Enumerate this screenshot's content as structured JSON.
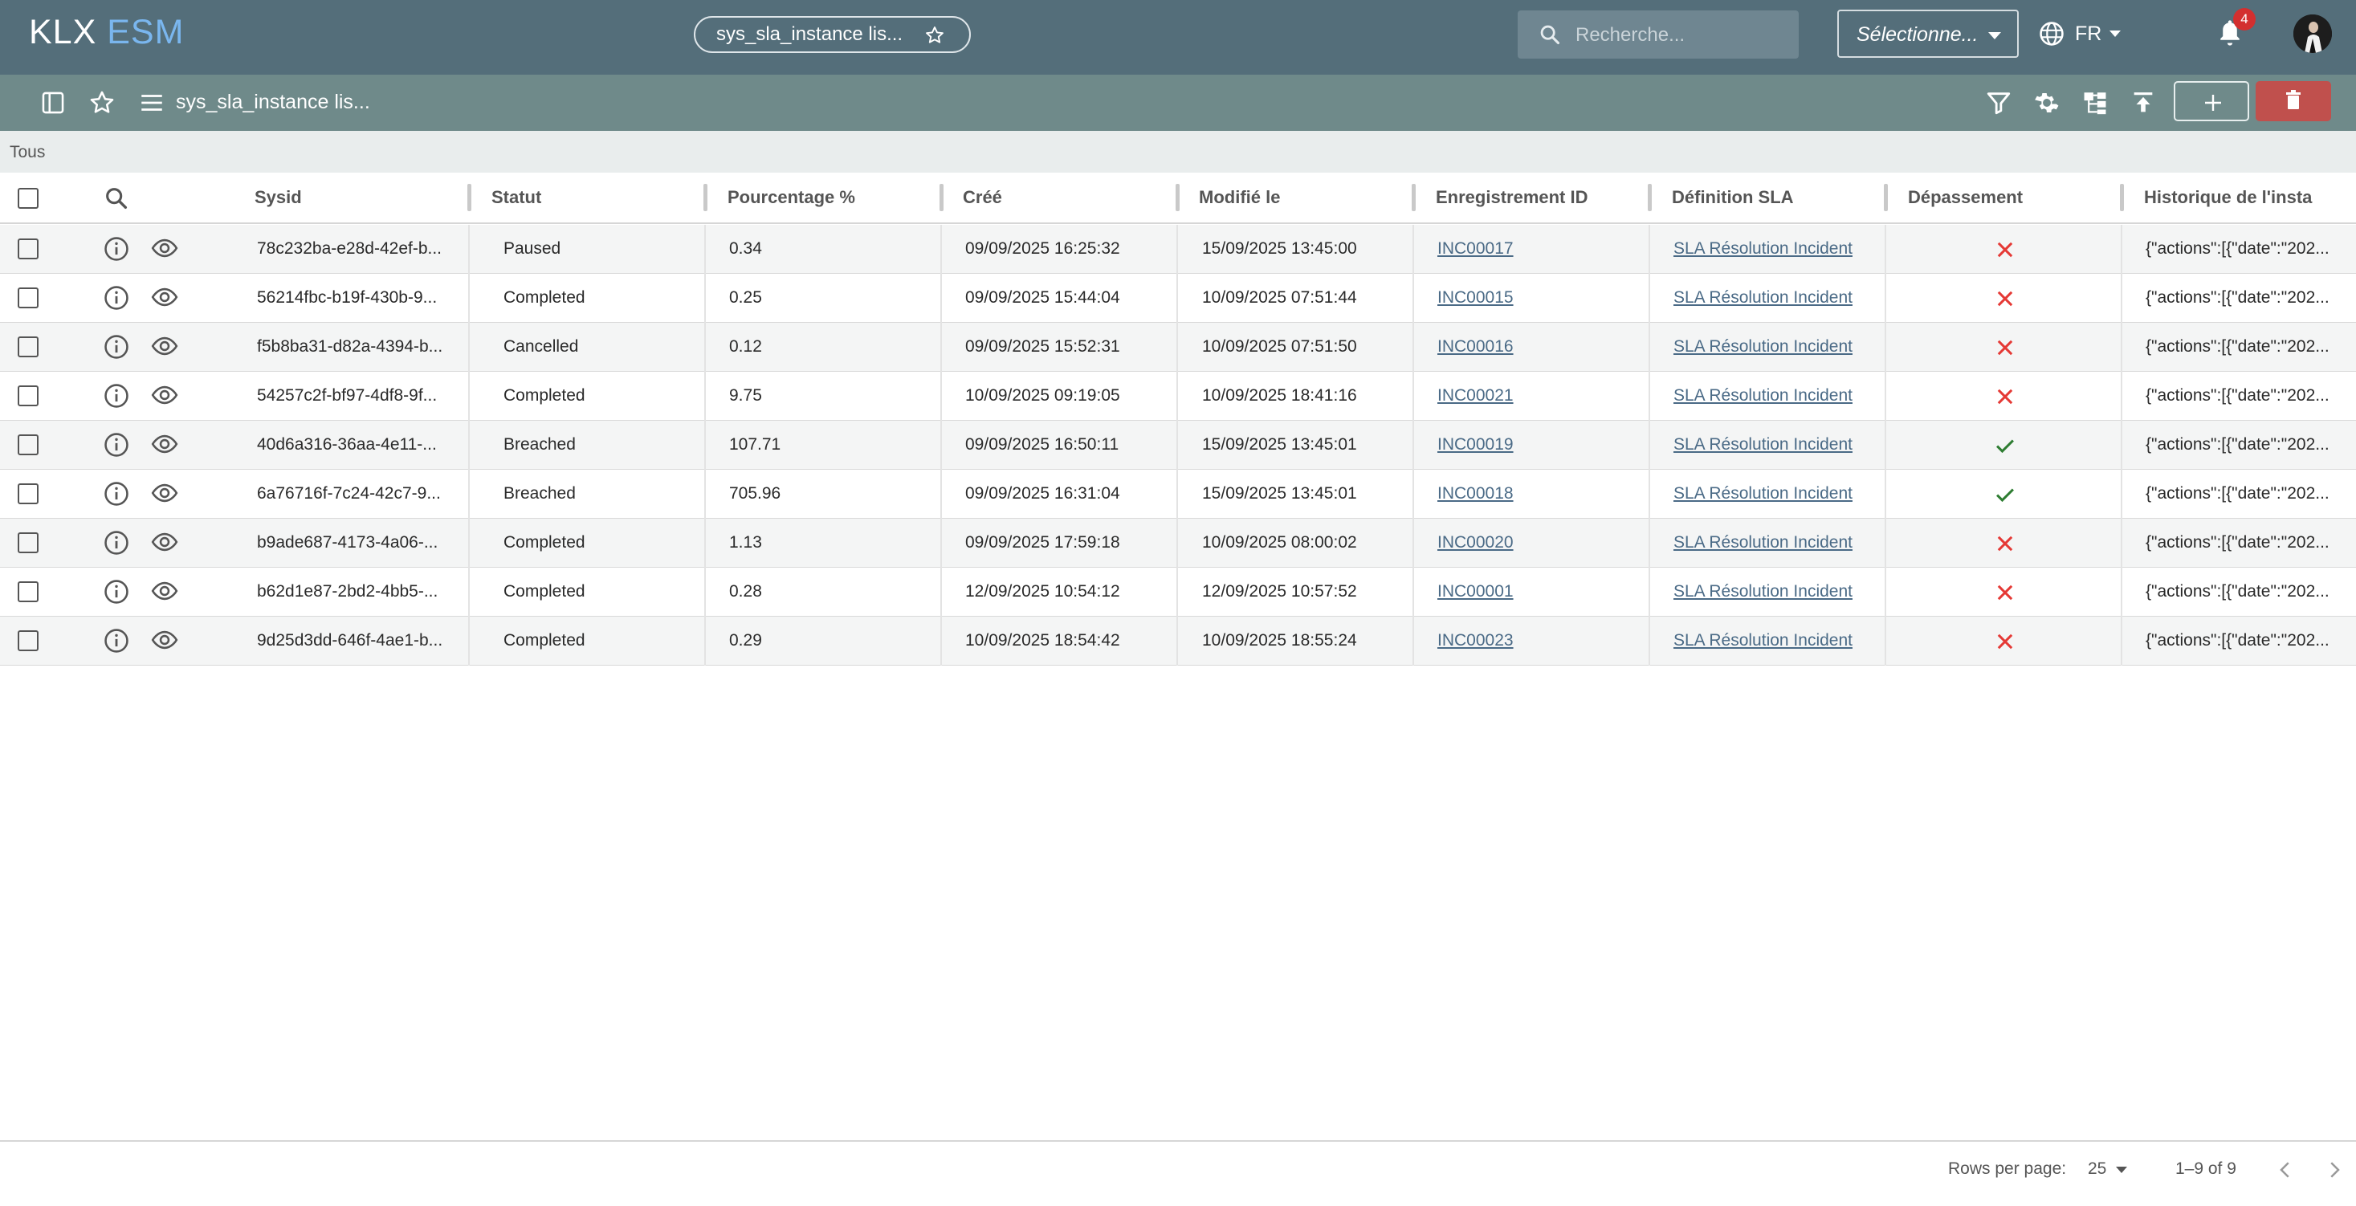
{
  "app": {
    "logo_main": "KLX",
    "logo_accent": "ESM"
  },
  "header": {
    "tab_label": "sys_sla_instance lis...",
    "search_placeholder": "Recherche...",
    "select_label": "Sélectionne...",
    "language": "FR",
    "notifications_count": "4"
  },
  "toolbar": {
    "title": "sys_sla_instance lis..."
  },
  "filter": {
    "label": "Tous"
  },
  "columns": [
    "Sysid",
    "Statut",
    "Pourcentage %",
    "Créé",
    "Modifié le",
    "Enregistrement ID",
    "Définition SLA",
    "Dépassement",
    "Historique de l'instar"
  ],
  "rows": [
    {
      "sysid": "78c232ba-e28d-42ef-b...",
      "statut": "Paused",
      "pct": "0.34",
      "cree": "09/09/2025 16:25:32",
      "modifie": "15/09/2025 13:45:00",
      "enreg": "INC00017",
      "def": "SLA Résolution Incident",
      "depassement": false,
      "hist": "{\"actions\":[{\"date\":\"202..."
    },
    {
      "sysid": "56214fbc-b19f-430b-9...",
      "statut": "Completed",
      "pct": "0.25",
      "cree": "09/09/2025 15:44:04",
      "modifie": "10/09/2025 07:51:44",
      "enreg": "INC00015",
      "def": "SLA Résolution Incident",
      "depassement": false,
      "hist": "{\"actions\":[{\"date\":\"202..."
    },
    {
      "sysid": "f5b8ba31-d82a-4394-b...",
      "statut": "Cancelled",
      "pct": "0.12",
      "cree": "09/09/2025 15:52:31",
      "modifie": "10/09/2025 07:51:50",
      "enreg": "INC00016",
      "def": "SLA Résolution Incident",
      "depassement": false,
      "hist": "{\"actions\":[{\"date\":\"202..."
    },
    {
      "sysid": "54257c2f-bf97-4df8-9f...",
      "statut": "Completed",
      "pct": "9.75",
      "cree": "10/09/2025 09:19:05",
      "modifie": "10/09/2025 18:41:16",
      "enreg": "INC00021",
      "def": "SLA Résolution Incident",
      "depassement": false,
      "hist": "{\"actions\":[{\"date\":\"202..."
    },
    {
      "sysid": "40d6a316-36aa-4e11-...",
      "statut": "Breached",
      "pct": "107.71",
      "cree": "09/09/2025 16:50:11",
      "modifie": "15/09/2025 13:45:01",
      "enreg": "INC00019",
      "def": "SLA Résolution Incident",
      "depassement": true,
      "hist": "{\"actions\":[{\"date\":\"202..."
    },
    {
      "sysid": "6a76716f-7c24-42c7-9...",
      "statut": "Breached",
      "pct": "705.96",
      "cree": "09/09/2025 16:31:04",
      "modifie": "15/09/2025 13:45:01",
      "enreg": "INC00018",
      "def": "SLA Résolution Incident",
      "depassement": true,
      "hist": "{\"actions\":[{\"date\":\"202..."
    },
    {
      "sysid": "b9ade687-4173-4a06-...",
      "statut": "Completed",
      "pct": "1.13",
      "cree": "09/09/2025 17:59:18",
      "modifie": "10/09/2025 08:00:02",
      "enreg": "INC00020",
      "def": "SLA Résolution Incident",
      "depassement": false,
      "hist": "{\"actions\":[{\"date\":\"202..."
    },
    {
      "sysid": "b62d1e87-2bd2-4bb5-...",
      "statut": "Completed",
      "pct": "0.28",
      "cree": "12/09/2025 10:54:12",
      "modifie": "12/09/2025 10:57:52",
      "enreg": "INC00001",
      "def": "SLA Résolution Incident",
      "depassement": false,
      "hist": "{\"actions\":[{\"date\":\"202..."
    },
    {
      "sysid": "9d25d3dd-646f-4ae1-b...",
      "statut": "Completed",
      "pct": "0.29",
      "cree": "10/09/2025 18:54:42",
      "modifie": "10/09/2025 18:55:24",
      "enreg": "INC00023",
      "def": "SLA Résolution Incident",
      "depassement": false,
      "hist": "{\"actions\":[{\"date\":\"202..."
    }
  ],
  "pagination": {
    "rows_per_page_label": "Rows per page:",
    "rows_per_page": "25",
    "range": "1–9 of 9"
  },
  "colors": {
    "header_bg": "#546e7a",
    "toolbar_bg": "#6f8a8a",
    "delete": "#c0504d",
    "cross": "#e53935",
    "check": "#2e7d32",
    "link": "#4a6a86"
  }
}
